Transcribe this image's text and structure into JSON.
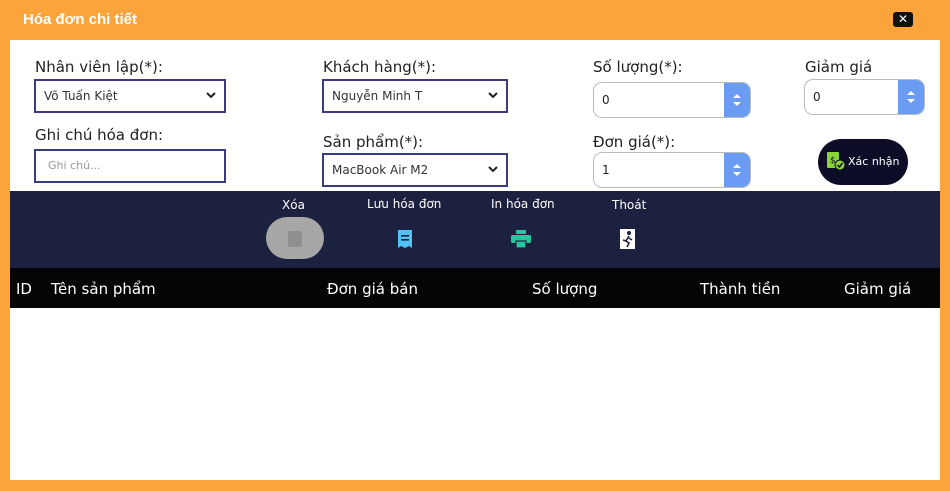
{
  "window": {
    "title": "Hóa đơn chi tiết",
    "close_symbol": "✕"
  },
  "form": {
    "nhan_vien": {
      "label": "Nhân viên lập(*):",
      "value": "Võ Tuấn Kiệt"
    },
    "khach_hang": {
      "label": "Khách hàng(*):",
      "value": "Nguyễn Minh T"
    },
    "so_luong": {
      "label": "Số lượng(*):",
      "value": "0"
    },
    "giam_gia": {
      "label": "Giảm giá",
      "value": "0"
    },
    "ghi_chu": {
      "label": "Ghi chú hóa đơn:",
      "placeholder": "Ghi chú..."
    },
    "san_pham": {
      "label": "Sản phẩm(*):",
      "value": "MacBook Air M2"
    },
    "don_gia": {
      "label": "Đơn giá(*):",
      "value": "1"
    },
    "confirm_label": "Xác nhận"
  },
  "toolbar": {
    "delete_label": "Xóa",
    "save_label": "Lưu hóa đơn",
    "print_label": "In hóa đơn",
    "exit_label": "Thoát"
  },
  "table": {
    "columns": [
      "ID",
      "Tên sản phẩm",
      "Đơn giá bán",
      "Số lượng",
      "Thành tiền",
      "Giảm giá"
    ],
    "rows": []
  },
  "colors": {
    "frame": "#fba43b",
    "toolbar_bg": "#1d2140",
    "header_bg": "#050505",
    "accent_blue": "#6b9cf4",
    "save_icon": "#4fc3f7",
    "print_icon": "#26c6a0"
  }
}
